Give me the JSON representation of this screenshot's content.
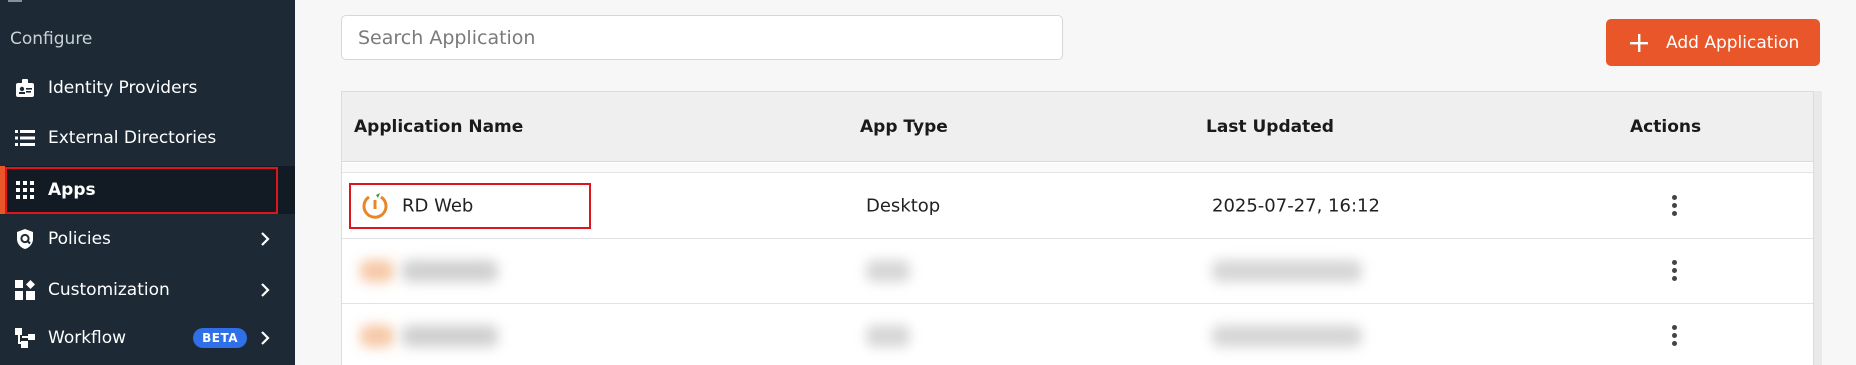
{
  "sidebar": {
    "section_title": "Configure",
    "items": [
      {
        "label": "Identity Providers",
        "icon": "id-badge-icon"
      },
      {
        "label": "External Directories",
        "icon": "list-icon"
      },
      {
        "label": "Apps",
        "icon": "grid-icon",
        "active": true
      },
      {
        "label": "Policies",
        "icon": "shield-icon",
        "has_chevron": true
      },
      {
        "label": "Customization",
        "icon": "widgets-icon",
        "has_chevron": true
      },
      {
        "label": "Workflow",
        "icon": "workflow-icon",
        "has_chevron": true,
        "badge": "BETA"
      }
    ]
  },
  "toolbar": {
    "search_placeholder": "Search Application",
    "add_label": "Add Application"
  },
  "table": {
    "headers": [
      "Application Name",
      "App Type",
      "Last Updated",
      "Actions"
    ],
    "rows": [
      {
        "name": "RD Web",
        "type": "Desktop",
        "updated": "2025-07-27, 16:12"
      }
    ]
  },
  "colors": {
    "sidebar_bg": "#1d2a35",
    "accent": "#e8562a",
    "highlight": "#e0141c",
    "beta": "#2f6fe8"
  }
}
